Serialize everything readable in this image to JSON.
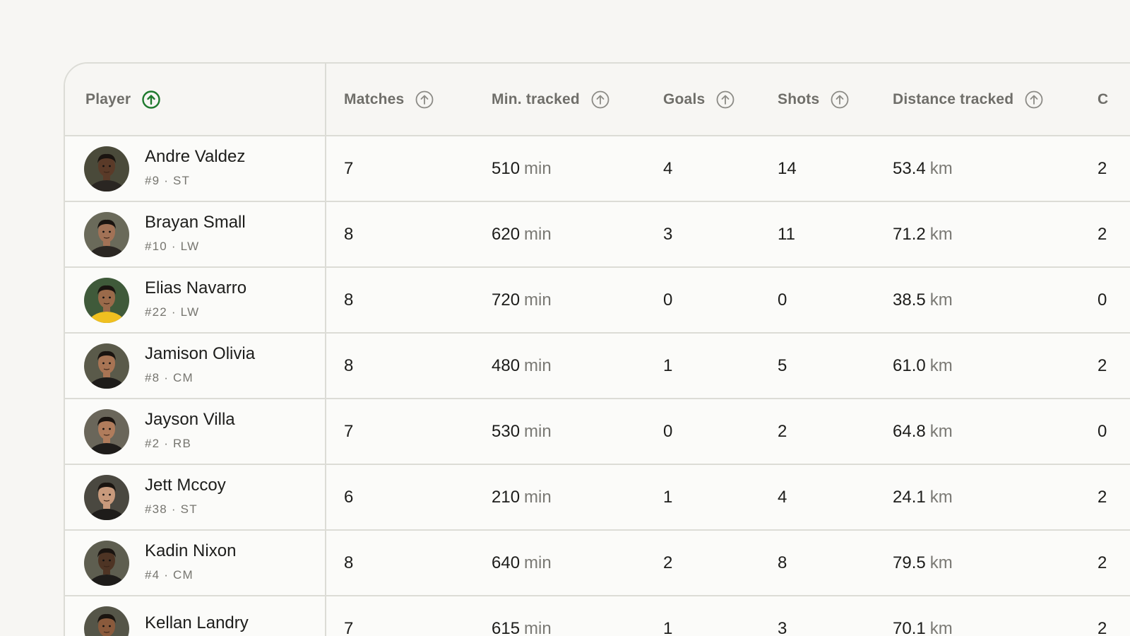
{
  "table": {
    "columns": [
      {
        "key": "player",
        "label": "Player",
        "sort_active": true
      },
      {
        "key": "matches",
        "label": "Matches",
        "sort_active": false
      },
      {
        "key": "min_tracked",
        "label": "Min. tracked",
        "sort_active": false
      },
      {
        "key": "goals",
        "label": "Goals",
        "sort_active": false
      },
      {
        "key": "shots",
        "label": "Shots",
        "sort_active": false
      },
      {
        "key": "distance",
        "label": "Distance tracked",
        "sort_active": false
      },
      {
        "key": "extra",
        "label": "C",
        "sort_active": false
      }
    ],
    "colors": {
      "sort_active": "#1f7a2e",
      "sort_inactive": "#8c8b86"
    },
    "rows": [
      {
        "name": "Andre Valdez",
        "meta": "#9 · ST",
        "matches": "7",
        "min": "510",
        "min_unit": "min",
        "goals": "4",
        "shots": "14",
        "distance": "53.4",
        "distance_unit": "km",
        "extra": "2",
        "avatar_skin": "#5a3a28",
        "avatar_shirt": "#2a2622"
      },
      {
        "name": "Brayan Small",
        "meta": "#10 · LW",
        "matches": "8",
        "min": "620",
        "min_unit": "min",
        "goals": "3",
        "shots": "11",
        "distance": "71.2",
        "distance_unit": "km",
        "extra": "2",
        "avatar_skin": "#a27256",
        "avatar_shirt": "#2a2622"
      },
      {
        "name": "Elias Navarro",
        "meta": "#22 · LW",
        "matches": "8",
        "min": "720",
        "min_unit": "min",
        "goals": "0",
        "shots": "0",
        "distance": "38.5",
        "distance_unit": "km",
        "extra": "0",
        "avatar_skin": "#9a6a4a",
        "avatar_shirt": "#f0c020"
      },
      {
        "name": "Jamison Olivia",
        "meta": "#8 · CM",
        "matches": "8",
        "min": "480",
        "min_unit": "min",
        "goals": "1",
        "shots": "5",
        "distance": "61.0",
        "distance_unit": "km",
        "extra": "2",
        "avatar_skin": "#a87454",
        "avatar_shirt": "#1e1c1a"
      },
      {
        "name": "Jayson Villa",
        "meta": "#2 · RB",
        "matches": "7",
        "min": "530",
        "min_unit": "min",
        "goals": "0",
        "shots": "2",
        "distance": "64.8",
        "distance_unit": "km",
        "extra": "0",
        "avatar_skin": "#b07c5c",
        "avatar_shirt": "#1e1c1a"
      },
      {
        "name": "Jett Mccoy",
        "meta": "#38 · ST",
        "matches": "6",
        "min": "210",
        "min_unit": "min",
        "goals": "1",
        "shots": "4",
        "distance": "24.1",
        "distance_unit": "km",
        "extra": "2",
        "avatar_skin": "#c89a7c",
        "avatar_shirt": "#1e1c1a"
      },
      {
        "name": "Kadin Nixon",
        "meta": "#4 · CM",
        "matches": "8",
        "min": "640",
        "min_unit": "min",
        "goals": "2",
        "shots": "8",
        "distance": "79.5",
        "distance_unit": "km",
        "extra": "2",
        "avatar_skin": "#4e3424",
        "avatar_shirt": "#1e1c1a"
      },
      {
        "name": "Kellan Landry",
        "meta": "",
        "matches": "7",
        "min": "615",
        "min_unit": "min",
        "goals": "1",
        "shots": "3",
        "distance": "70.1",
        "distance_unit": "km",
        "extra": "2",
        "avatar_skin": "#8a5a3c",
        "avatar_shirt": "#1e1c1a"
      }
    ]
  }
}
